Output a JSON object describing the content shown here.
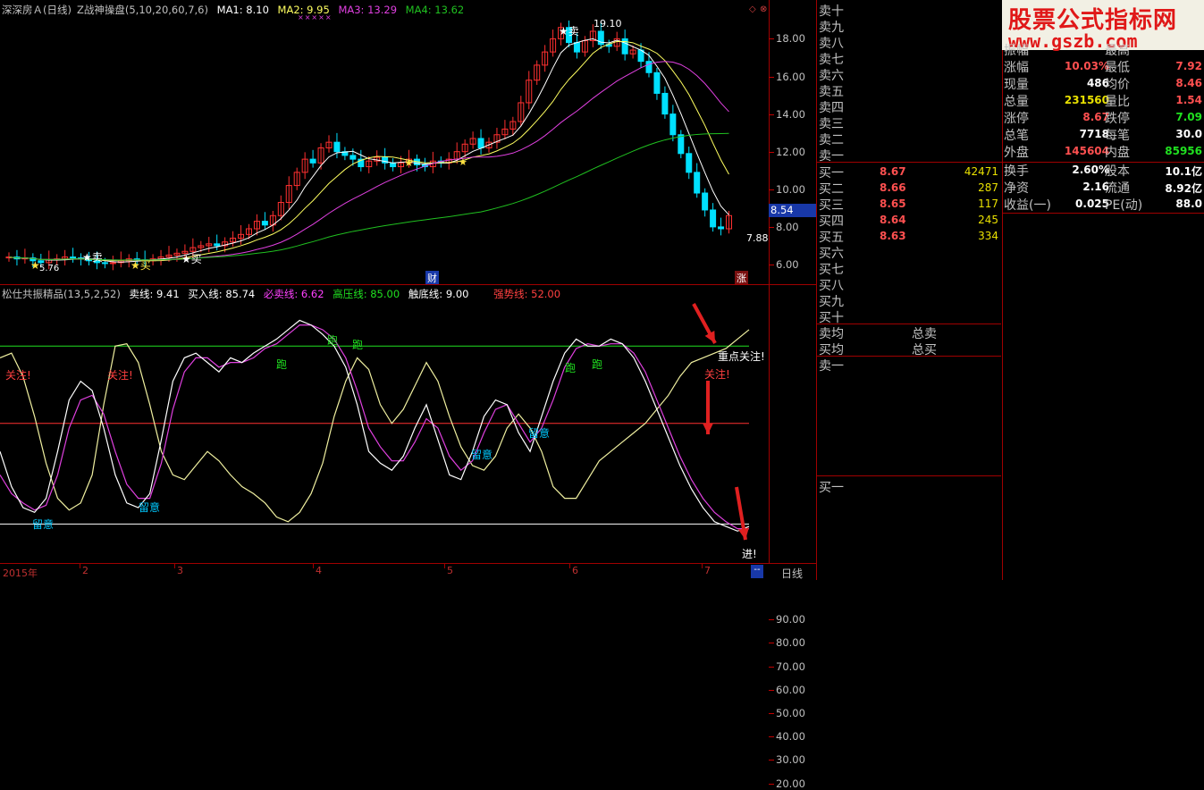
{
  "colors": {
    "up": "#ff3030",
    "down": "#00e0ff",
    "ma1": "#ffffff",
    "ma2": "#ffff60",
    "ma3": "#e040e0",
    "ma4": "#20c020",
    "grid": "#a00000",
    "cyan": "#00c8ff",
    "yellow": "#e8e000",
    "magenta": "#ff40ff",
    "green": "#20e020"
  },
  "header": {
    "stock": "深深房Ａ(日线)",
    "formula": "Z战神操盘",
    "params": "(5,10,20,60,7,6)",
    "ma1": "MA1: 8.10",
    "ma2": "MA2: 9.95",
    "ma3": "MA3: 13.29",
    "ma4": "MA4: 13.62"
  },
  "price_axis": [
    "18.00",
    "16.00",
    "14.00",
    "12.00",
    "10.00",
    "8.00",
    "6.00"
  ],
  "current_price_tag": "8.54",
  "price_notes": {
    "high": "19.10",
    "low": "7.88",
    "low_early": "5.76",
    "sell_star": "卖",
    "buy_star": "买",
    "cai": "财",
    "limit": "涨"
  },
  "ind_header": {
    "name": "松仕共振精品(13,5,2,52)",
    "sell": "卖线: 9.41",
    "buy": "买入线: 85.74",
    "must_sell": "必卖线: 6.62",
    "high_line": "高压线: 85.00",
    "bottom_line": "触底线: 9.00",
    "strong": "强势线: 52.00"
  },
  "ind_axis": [
    "90.00",
    "80.00",
    "70.00",
    "60.00",
    "50.00",
    "40.00",
    "30.00",
    "20.00"
  ],
  "ind_notes": {
    "guanzhu": "关注!",
    "zhuyi": "留意",
    "pao": "跑",
    "focus": "重点关注!",
    "jin": "进!"
  },
  "time_axis": {
    "year": "2015年",
    "months": [
      "2",
      "3",
      "4",
      "5",
      "6",
      "7"
    ],
    "period": "日线",
    "nav": "--"
  },
  "order_book": {
    "sells": [
      "卖十",
      "卖九",
      "卖八",
      "卖七",
      "卖六",
      "卖五",
      "卖四",
      "卖三",
      "卖二",
      "卖一"
    ],
    "buys": [
      {
        "label": "买一",
        "price": "8.67",
        "vol": "42471"
      },
      {
        "label": "买二",
        "price": "8.66",
        "vol": "287"
      },
      {
        "label": "买三",
        "price": "8.65",
        "vol": "117"
      },
      {
        "label": "买四",
        "price": "8.64",
        "vol": "245"
      },
      {
        "label": "买五",
        "price": "8.63",
        "vol": "334"
      },
      {
        "label": "买六",
        "price": "",
        "vol": ""
      },
      {
        "label": "买七",
        "price": "",
        "vol": ""
      },
      {
        "label": "买八",
        "price": "",
        "vol": ""
      },
      {
        "label": "买九",
        "price": "",
        "vol": ""
      },
      {
        "label": "买十",
        "price": "",
        "vol": ""
      }
    ],
    "avg_sell": "卖均",
    "avg_buy": "买均",
    "total_sell": "总卖",
    "total_buy": "总买",
    "sell1": "卖一",
    "buy1": "买一"
  },
  "banner": {
    "title": "股票公式指标网",
    "url": "www.gszb.com"
  },
  "stats": [
    {
      "l1": "振幅",
      "v1": "",
      "c1": "#c0c0c0",
      "l2": "最高",
      "v2": "",
      "c2": "#ff5050"
    },
    {
      "l1": "涨幅",
      "v1": "10.03%",
      "c1": "#ff5050",
      "l2": "最低",
      "v2": "7.92",
      "c2": "#ff5050"
    },
    {
      "l1": "现量",
      "v1": "486",
      "c1": "#ffffff",
      "l2": "均价",
      "v2": "8.46",
      "c2": "#ff5050"
    },
    {
      "l1": "总量",
      "v1": "231560",
      "c1": "#e8e000",
      "l2": "量比",
      "v2": "1.54",
      "c2": "#ff5050"
    },
    {
      "l1": "涨停",
      "v1": "8.67",
      "c1": "#ff5050",
      "l2": "跌停",
      "v2": "7.09",
      "c2": "#20e020"
    },
    {
      "l1": "总笔",
      "v1": "7718",
      "c1": "#ffffff",
      "l2": "每笔",
      "v2": "30.0",
      "c2": "#ffffff"
    },
    {
      "l1": "外盘",
      "v1": "145604",
      "c1": "#ff5050",
      "l2": "内盘",
      "v2": "85956",
      "c2": "#20e020"
    },
    {
      "l1": "换手",
      "v1": "2.60%",
      "c1": "#ffffff",
      "l2": "股本",
      "v2": "10.1亿",
      "c2": "#ffffff"
    },
    {
      "l1": "净资",
      "v1": "2.16",
      "c1": "#ffffff",
      "l2": "流通",
      "v2": "8.92亿",
      "c2": "#ffffff"
    },
    {
      "l1": "收益(一)",
      "v1": "0.025",
      "c1": "#ffffff",
      "l2": "PE(动)",
      "v2": "88.0",
      "c2": "#ffffff"
    }
  ]
}
